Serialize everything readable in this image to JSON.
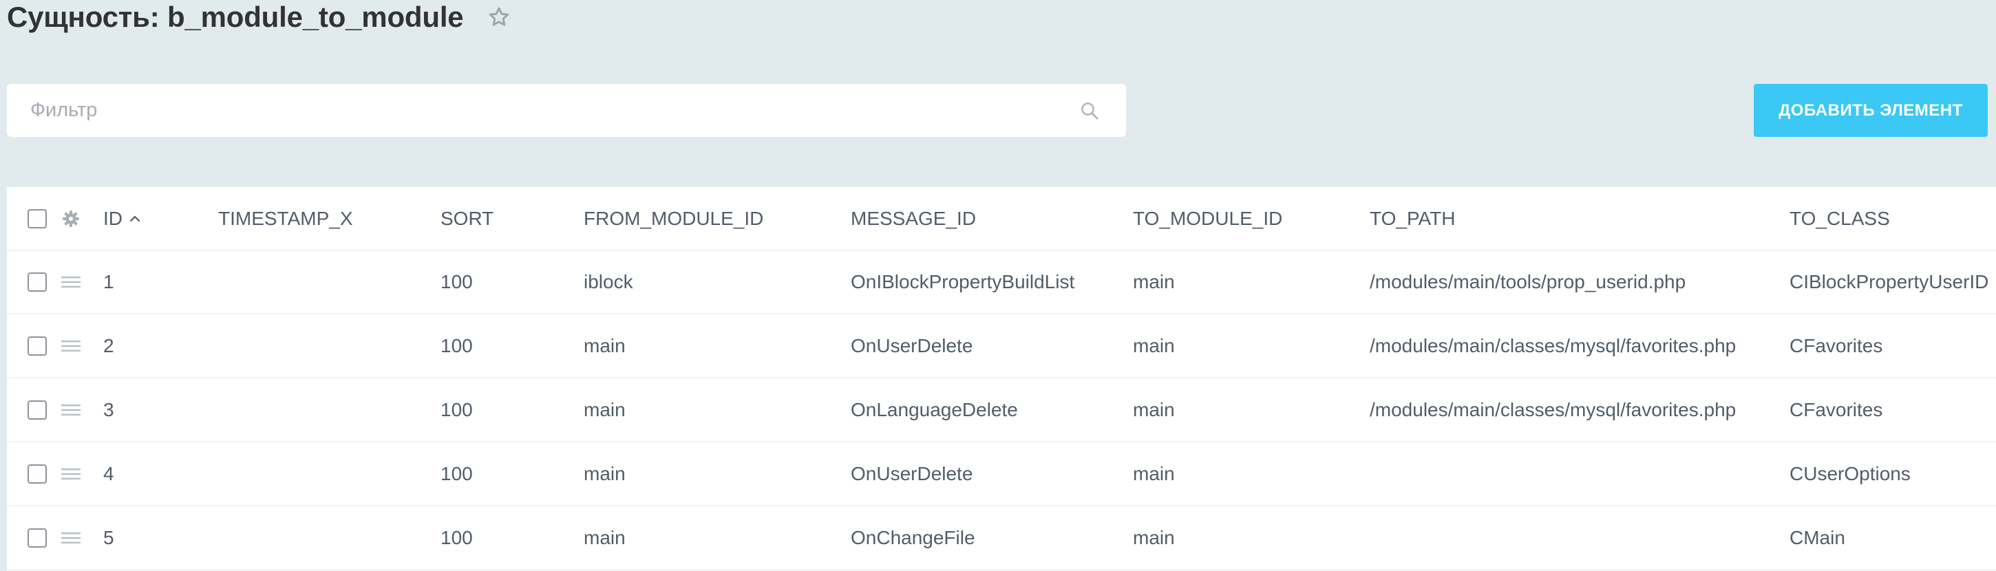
{
  "page": {
    "title": "Сущность: b_module_to_module"
  },
  "filter": {
    "placeholder": "Фильтр"
  },
  "toolbar": {
    "add_button_label": "ДОБАВИТЬ ЭЛЕМЕНТ"
  },
  "colors": {
    "background": "#e1ebed",
    "accent": "#3bc8f5",
    "text": "#535c69"
  },
  "icons": [
    "star-icon",
    "search-icon",
    "gear-icon",
    "sort-ascending-icon",
    "drag-handle-icon"
  ],
  "grid": {
    "columns": [
      "ID",
      "TIMESTAMP_X",
      "SORT",
      "FROM_MODULE_ID",
      "MESSAGE_ID",
      "TO_MODULE_ID",
      "TO_PATH",
      "TO_CLASS"
    ],
    "sorted_column": "ID",
    "sort_direction": "ascending",
    "rows": [
      {
        "id": "1",
        "timestamp_x": "",
        "sort": "100",
        "from_module_id": "iblock",
        "message_id": "OnIBlockPropertyBuildList",
        "to_module_id": "main",
        "to_path": "/modules/main/tools/prop_userid.php",
        "to_class": "CIBlockPropertyUserID"
      },
      {
        "id": "2",
        "timestamp_x": "",
        "sort": "100",
        "from_module_id": "main",
        "message_id": "OnUserDelete",
        "to_module_id": "main",
        "to_path": "/modules/main/classes/mysql/favorites.php",
        "to_class": "CFavorites"
      },
      {
        "id": "3",
        "timestamp_x": "",
        "sort": "100",
        "from_module_id": "main",
        "message_id": "OnLanguageDelete",
        "to_module_id": "main",
        "to_path": "/modules/main/classes/mysql/favorites.php",
        "to_class": "CFavorites"
      },
      {
        "id": "4",
        "timestamp_x": "",
        "sort": "100",
        "from_module_id": "main",
        "message_id": "OnUserDelete",
        "to_module_id": "main",
        "to_path": "",
        "to_class": "CUserOptions"
      },
      {
        "id": "5",
        "timestamp_x": "",
        "sort": "100",
        "from_module_id": "main",
        "message_id": "OnChangeFile",
        "to_module_id": "main",
        "to_path": "",
        "to_class": "CMain"
      }
    ]
  }
}
